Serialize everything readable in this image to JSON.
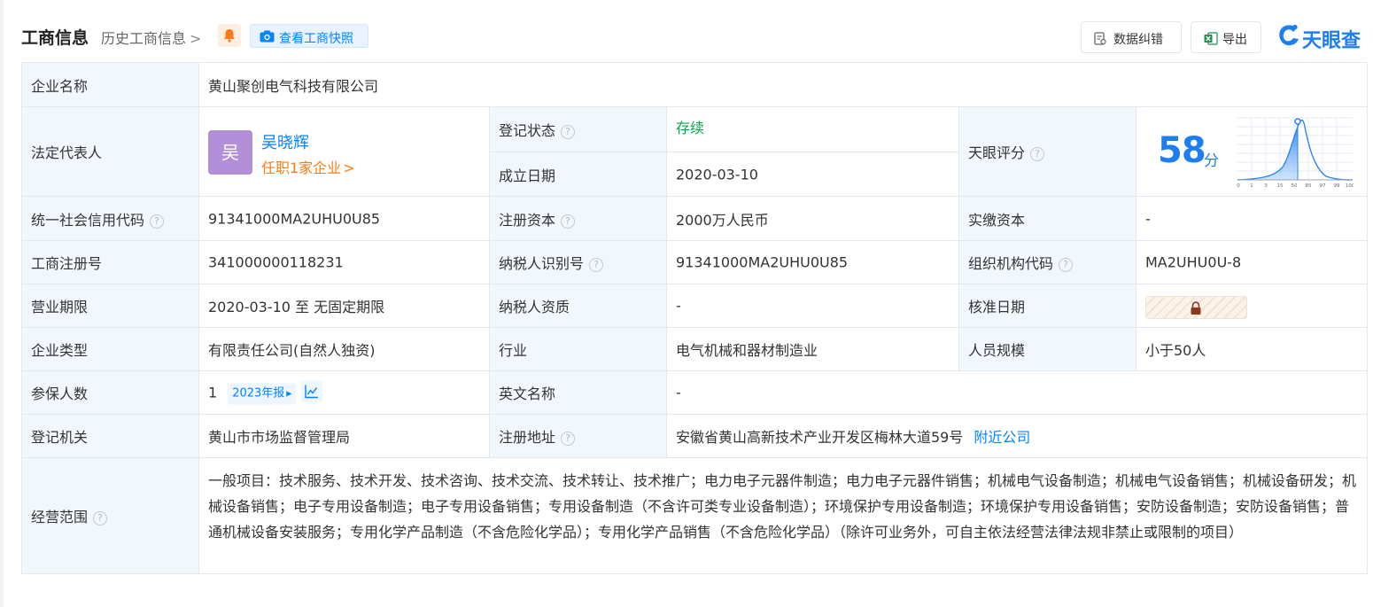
{
  "header": {
    "title": "工商信息",
    "history_link": "历史工商信息",
    "snapshot_button": "查看工商快照",
    "error_button": "数据纠错",
    "export_button": "导出",
    "logo_text": "天眼查",
    "accent_color": "#0084ff"
  },
  "rows": {
    "company_name": {
      "label": "企业名称",
      "value": "黄山聚创电气科技有限公司"
    },
    "legal_rep": {
      "label": "法定代表人",
      "avatar_char": "吴",
      "name": "吴晓辉",
      "positions": "任职1家企业"
    },
    "reg_status": {
      "label": "登记状态",
      "value": "存续"
    },
    "found_date": {
      "label": "成立日期",
      "value": "2020-03-10"
    },
    "tianyan_score": {
      "label": "天眼评分",
      "score": "58",
      "unit": "分",
      "axis_ticks": [
        "0",
        "1",
        "3",
        "15",
        "50",
        "85",
        "97",
        "99",
        "100"
      ]
    },
    "credit_code": {
      "label": "统一社会信用代码",
      "value": "91341000MA2UHU0U85"
    },
    "reg_capital": {
      "label": "注册资本",
      "value": "2000万人民币"
    },
    "paid_capital": {
      "label": "实缴资本",
      "value": "-"
    },
    "reg_number": {
      "label": "工商注册号",
      "value": "341000000118231"
    },
    "taxpayer_id": {
      "label": "纳税人识别号",
      "value": "91341000MA2UHU0U85"
    },
    "org_code": {
      "label": "组织机构代码",
      "value": "MA2UHU0U-8"
    },
    "business_term": {
      "label": "营业期限",
      "value": "2020-03-10 至 无固定期限"
    },
    "taxpayer_qual": {
      "label": "纳税人资质",
      "value": "-"
    },
    "approval_date": {
      "label": "核准日期",
      "value": ""
    },
    "company_type": {
      "label": "企业类型",
      "value": "有限责任公司(自然人独资)"
    },
    "industry": {
      "label": "行业",
      "value": "电气机械和器材制造业"
    },
    "staff_size": {
      "label": "人员规模",
      "value": "小于50人"
    },
    "insured": {
      "label": "参保人数",
      "value": "1",
      "report_tag": "2023年报"
    },
    "english_name": {
      "label": "英文名称",
      "value": "-"
    },
    "reg_authority": {
      "label": "登记机关",
      "value": "黄山市市场监督管理局"
    },
    "reg_address": {
      "label": "注册地址",
      "value": "安徽省黄山高新技术产业开发区梅林大道59号",
      "link": "附近公司"
    },
    "business_scope": {
      "label": "经营范围",
      "value": "一般项目：技术服务、技术开发、技术咨询、技术交流、技术转让、技术推广；电力电子元器件制造；电力电子元器件销售；机械电气设备制造；机械电气设备销售；机械设备研发；机械设备销售；电子专用设备制造；电子专用设备销售；专用设备制造（不含许可类专业设备制造）；环境保护专用设备制造；环境保护专用设备销售；安防设备制造；安防设备销售；普通机械设备安装服务；专用化学产品制造（不含危险化学品）；专用化学产品销售（不含危险化学品）（除许可业务外，可自主依法经营法律法规非禁止或限制的项目）"
    }
  }
}
